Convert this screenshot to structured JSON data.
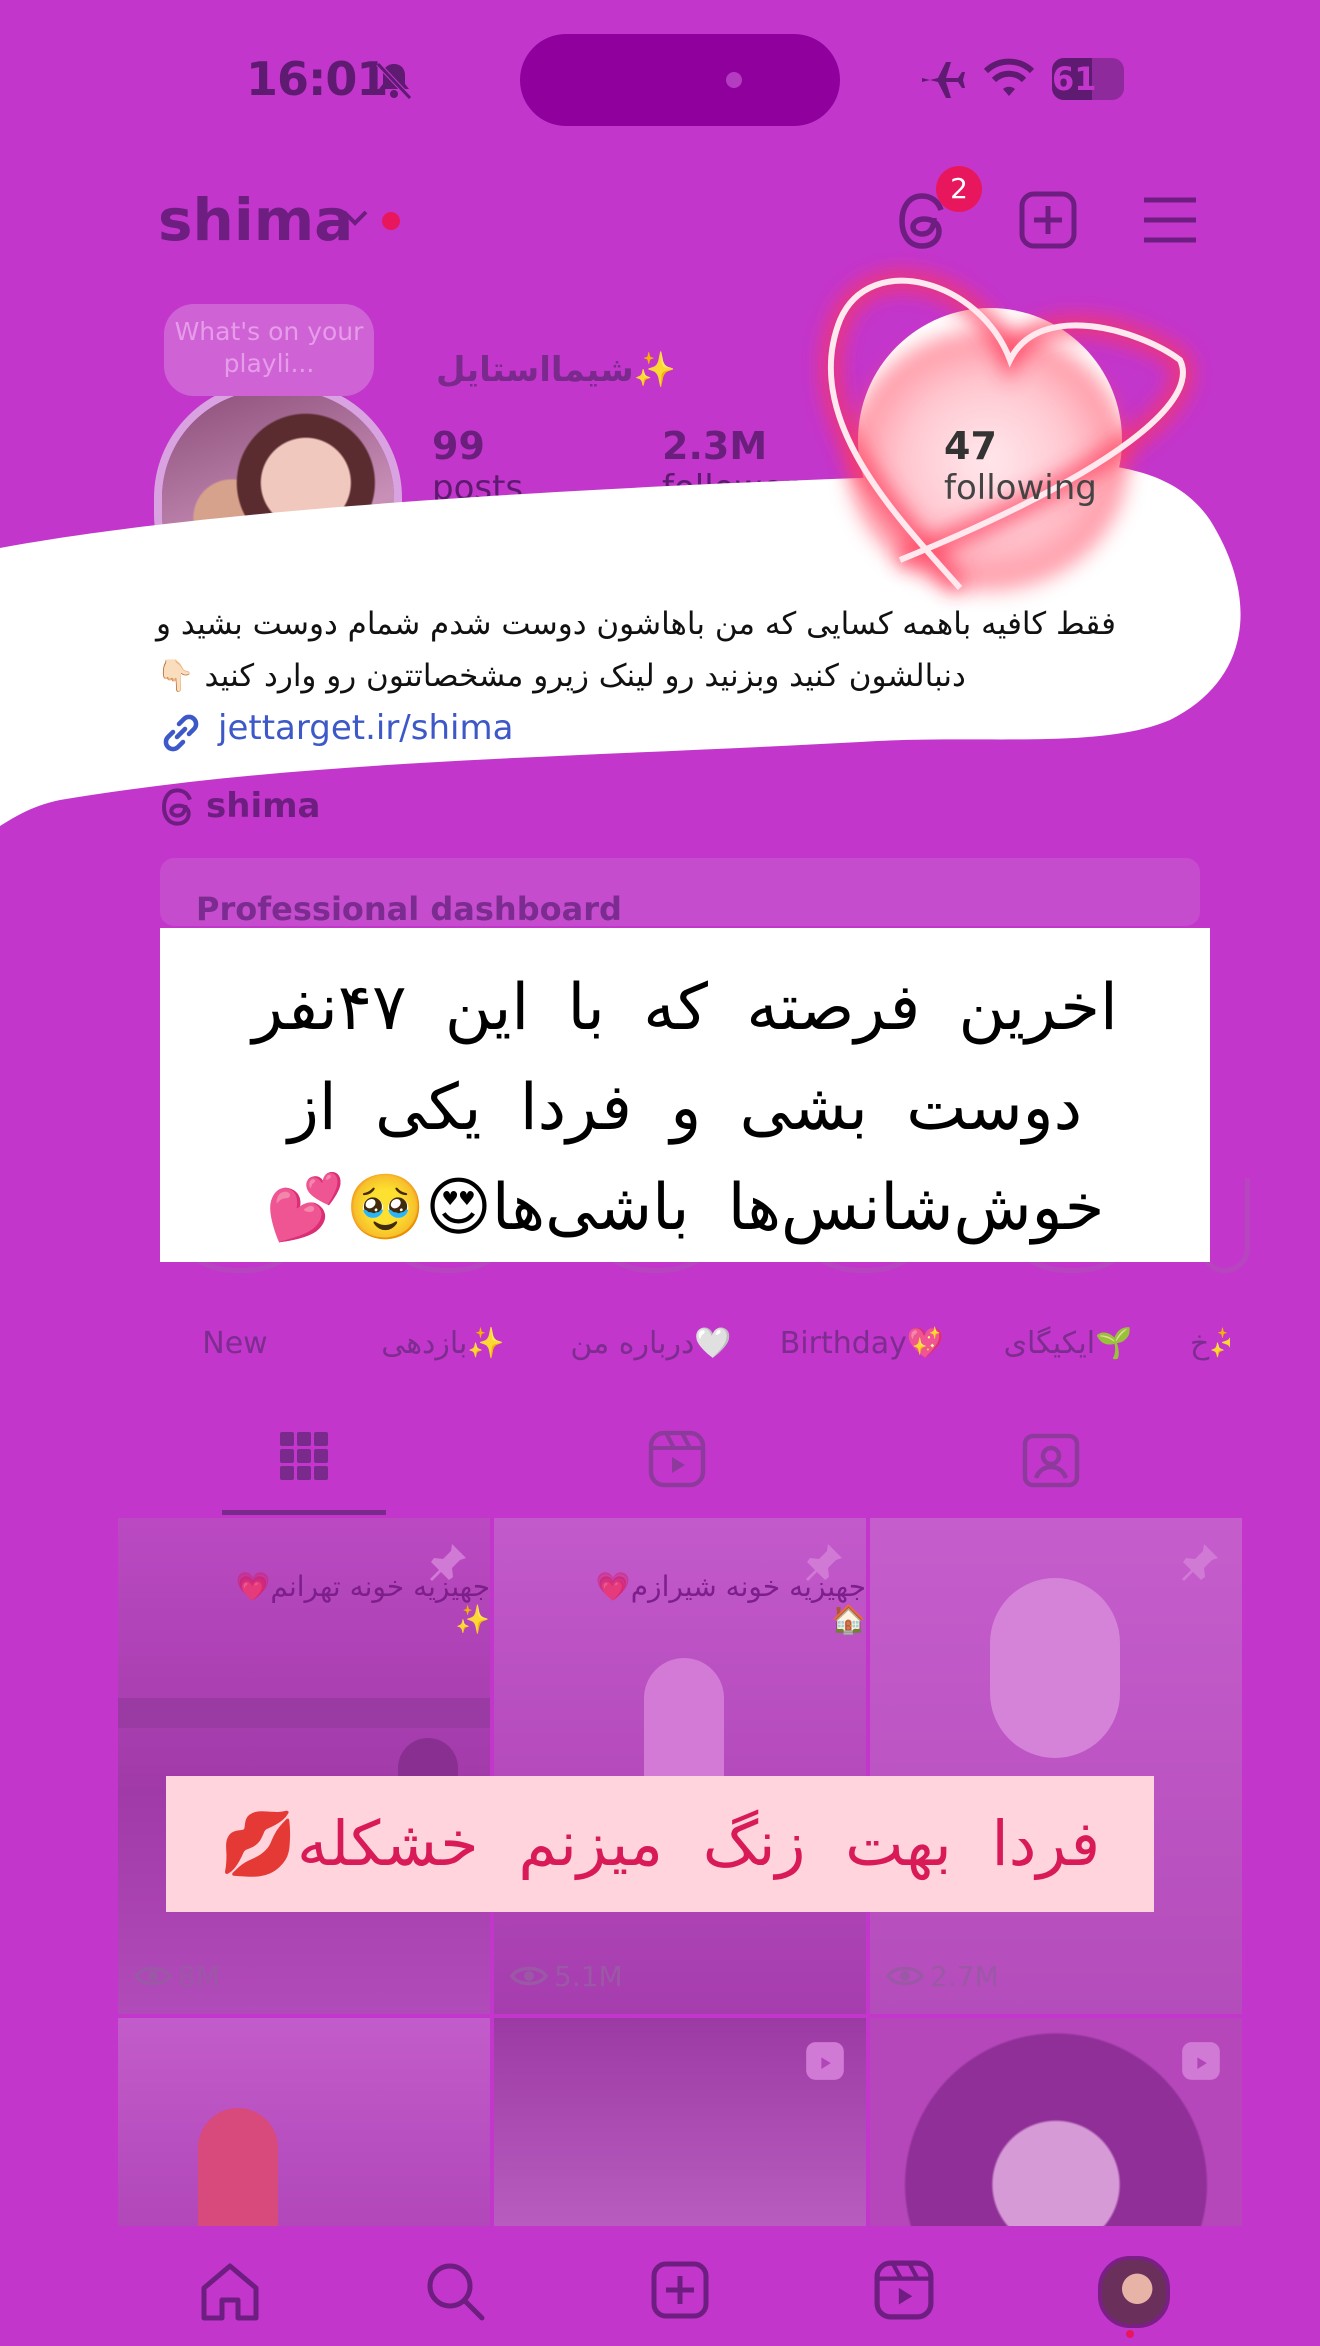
{
  "status_bar": {
    "time": "16:01",
    "battery": "61"
  },
  "header": {
    "username": "shima",
    "threads_badge": "2"
  },
  "profile": {
    "note_text": "What's on your playli...",
    "display_name": "شیمااستایل✨",
    "stats": [
      {
        "value": "99",
        "label": "posts"
      },
      {
        "value": "2.3M",
        "label": "followers"
      },
      {
        "value": "47",
        "label": "following"
      }
    ],
    "bio_line1": "فقط کافیه باهمه کسایی که من باهاشون دوست شدم شمام دوست بشید و",
    "bio_line2": "دنبالشون کنید وبزنید رو لینک زیرو مشخصاتتون رو وارد کنید 👇🏻",
    "link": "jettarget.ir/shima",
    "threads_name": "shima"
  },
  "dashboard": {
    "label": "Professional dashboard"
  },
  "caption_top": {
    "line1": "اخرین فرصته که با این ۴۷نفر",
    "line2": "دوست بشی و فردا یکی از",
    "line3": "خوش‌شانس‌ها باشی‌ها😍🥹💕"
  },
  "highlights": [
    "New",
    "بازدهی✨",
    "درباره من🤍",
    "Birthday💖",
    "ایکیگای🌱",
    "خ✨"
  ],
  "grid": {
    "posts": [
      {
        "title": "جهیزیه خونه تهرانم💗✨",
        "views": "8M"
      },
      {
        "title": "جهیزیه خونه شیرازم💗🏠",
        "views": "5.1M"
      },
      {
        "title": "",
        "views": "2.7M"
      }
    ]
  },
  "caption_bottom": "فردا بهت زنگ میزنم خشکله💋",
  "colors": {
    "overlay": "#c336cc",
    "accent_red": "#e8175d",
    "link": "#3d58c8"
  }
}
